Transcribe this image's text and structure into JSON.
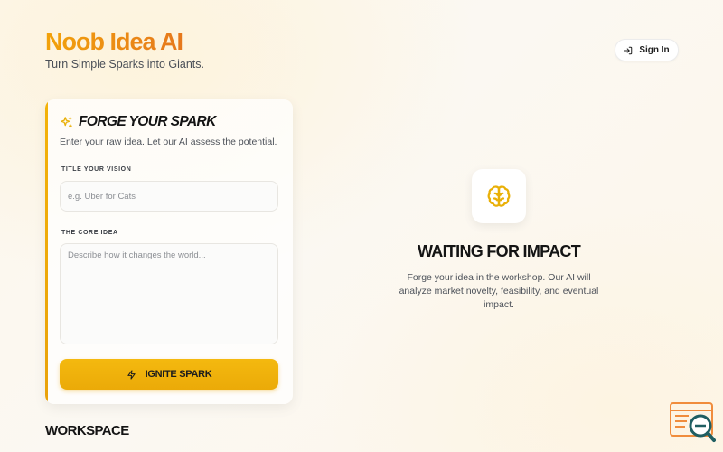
{
  "header": {
    "app_title": "Noob Idea AI",
    "tagline": "Turn Simple Sparks into Giants.",
    "signin_label": "Sign In"
  },
  "form": {
    "title": "FORGE YOUR SPARK",
    "subtitle": "Enter your raw idea. Let our AI assess the potential.",
    "vision_label": "TITLE YOUR VISION",
    "vision_placeholder": "e.g. Uber for Cats",
    "vision_value": "",
    "core_label": "THE CORE IDEA",
    "core_placeholder": "Describe how it changes the world...",
    "core_value": "",
    "submit_label": "IGNITE SPARK"
  },
  "results": {
    "title": "WAITING FOR IMPACT",
    "description": "Forge your idea in the workshop. Our AI will analyze market novelty, feasibility, and eventual impact."
  },
  "workspace": {
    "label": "WORKSPACE"
  },
  "icons": {
    "signin": "login-icon",
    "spark": "sparkles-icon",
    "ignite": "zap-icon",
    "brain": "brain-icon",
    "corner": "search-doc-logo-icon"
  },
  "colors": {
    "accent": "#f2a20a",
    "accent_dark": "#e5701c",
    "button": "#f4b90f",
    "icon_gold": "#e9b008",
    "corner_orange": "#f08c3c",
    "corner_teal": "#1f5e62"
  }
}
